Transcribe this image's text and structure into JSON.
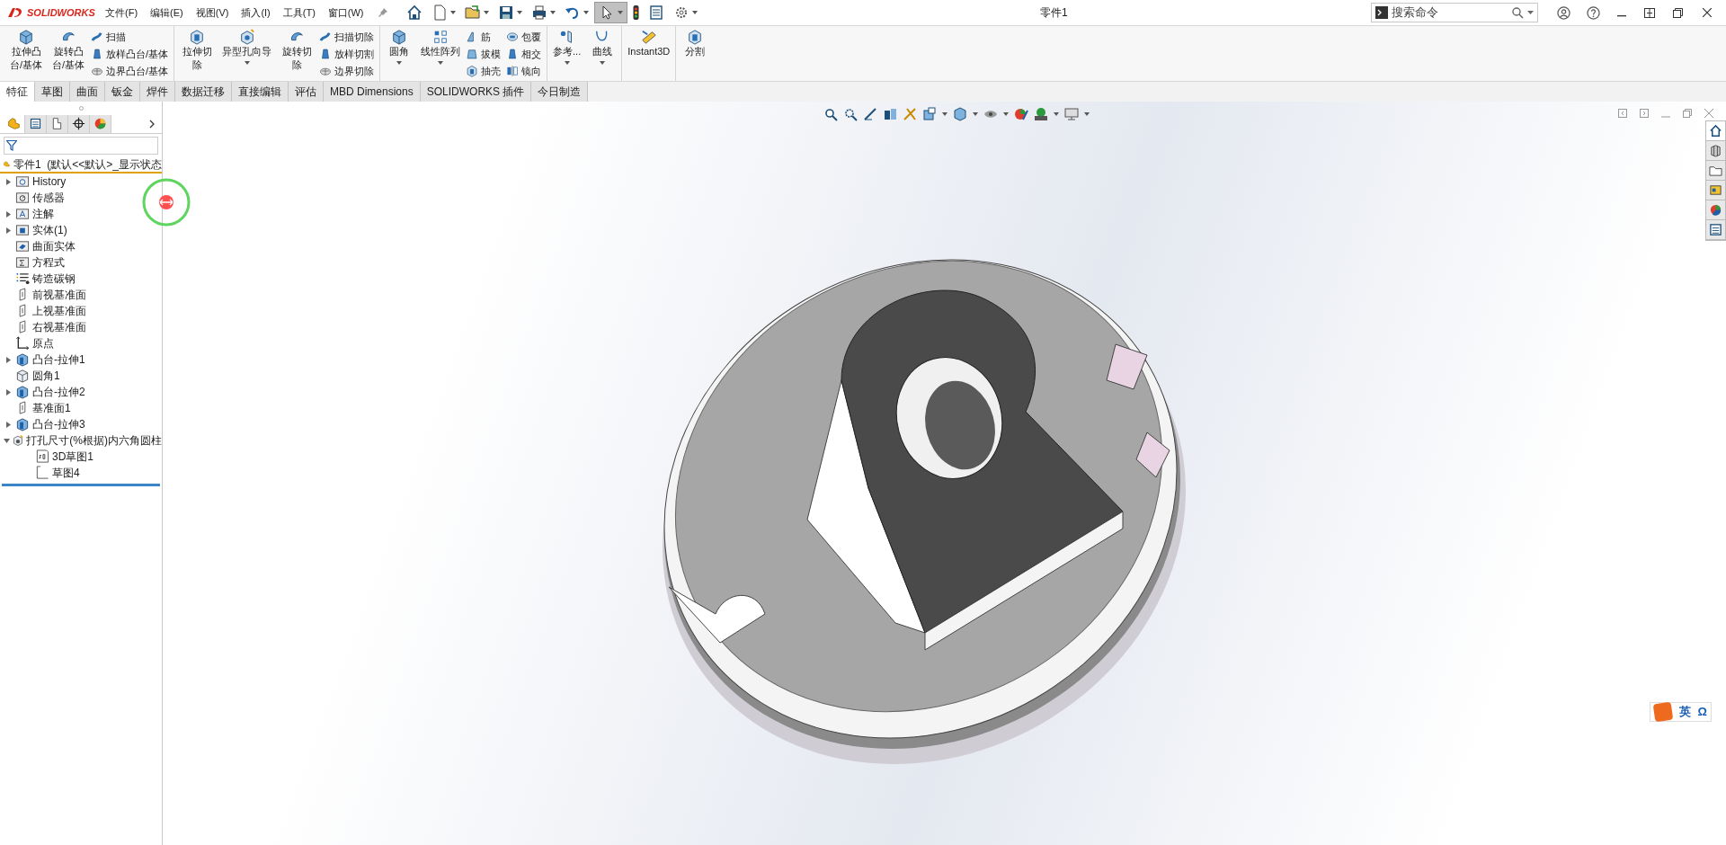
{
  "app": {
    "brand": "SOLIDWORKS",
    "title": "零件1"
  },
  "menu": [
    {
      "label": "文件(F)"
    },
    {
      "label": "编辑(E)"
    },
    {
      "label": "视图(V)"
    },
    {
      "label": "插入(I)"
    },
    {
      "label": "工具(T)"
    },
    {
      "label": "窗口(W)"
    }
  ],
  "quick_toolbar": [
    {
      "kind": "home",
      "caret": false,
      "selected": false
    },
    {
      "kind": "new",
      "caret": true,
      "selected": false
    },
    {
      "kind": "open",
      "caret": true,
      "selected": false
    },
    {
      "kind": "save",
      "caret": true,
      "selected": false
    },
    {
      "kind": "print",
      "caret": true,
      "selected": false
    },
    {
      "kind": "undo",
      "caret": true,
      "selected": false
    },
    {
      "kind": "select",
      "caret": true,
      "selected": true
    },
    {
      "kind": "light",
      "caret": false,
      "selected": false
    },
    {
      "kind": "list",
      "caret": false,
      "selected": false
    },
    {
      "kind": "gear",
      "caret": true,
      "selected": false
    }
  ],
  "search": {
    "placeholder": "搜索命令"
  },
  "ribbon": [
    {
      "columns": [
        {
          "kind": "tall",
          "items": [
            {
              "label": "拉伸凸台/基体",
              "kind": "cube",
              "caret": false
            }
          ]
        },
        {
          "kind": "tall",
          "items": [
            {
              "label": "旋转凸台/基体",
              "kind": "revolve",
              "caret": false
            }
          ]
        },
        {
          "kind": "small",
          "items": [
            {
              "label": "扫描",
              "kind": "sweep"
            },
            {
              "label": "放样凸台/基体",
              "kind": "loft"
            },
            {
              "label": "边界凸台/基体",
              "kind": "boundary"
            }
          ]
        }
      ]
    },
    {
      "columns": [
        {
          "kind": "tall",
          "items": [
            {
              "label": "拉伸切除",
              "kind": "cut",
              "caret": false
            }
          ]
        },
        {
          "kind": "large",
          "items": [
            {
              "label": "异型孔向导",
              "kind": "hole",
              "caret": true
            }
          ]
        },
        {
          "kind": "tall",
          "items": [
            {
              "label": "旋转切除",
              "kind": "revolve",
              "caret": false
            }
          ]
        },
        {
          "kind": "small",
          "items": [
            {
              "label": "扫描切除",
              "kind": "sweep"
            },
            {
              "label": "放样切割",
              "kind": "loft"
            },
            {
              "label": "边界切除",
              "kind": "boundary"
            }
          ]
        }
      ]
    },
    {
      "columns": [
        {
          "kind": "large",
          "items": [
            {
              "label": "圆角",
              "kind": "cube",
              "caret": true
            }
          ]
        },
        {
          "kind": "large",
          "items": [
            {
              "label": "线性阵列",
              "kind": "pattern",
              "caret": true
            }
          ]
        },
        {
          "kind": "small",
          "items": [
            {
              "label": "筋",
              "kind": "rib"
            },
            {
              "label": "拔模",
              "kind": "draft"
            },
            {
              "label": "抽壳",
              "kind": "cut"
            }
          ]
        },
        {
          "kind": "small",
          "items": [
            {
              "label": "包覆",
              "kind": "wrap"
            },
            {
              "label": "相交",
              "kind": "loft"
            },
            {
              "label": "镜向",
              "kind": "mirror"
            }
          ]
        }
      ]
    },
    {
      "columns": [
        {
          "kind": "large",
          "items": [
            {
              "label": "参考...",
              "kind": "reference",
              "caret": true
            }
          ]
        },
        {
          "kind": "large",
          "items": [
            {
              "label": "曲线",
              "kind": "curve",
              "caret": true
            }
          ]
        }
      ]
    },
    {
      "columns": [
        {
          "kind": "large",
          "items": [
            {
              "label": "Instant3D",
              "kind": "ruler",
              "caret": false
            }
          ]
        }
      ]
    },
    {
      "columns": [
        {
          "kind": "large",
          "items": [
            {
              "label": "分割",
              "kind": "cut",
              "caret": false
            }
          ]
        }
      ]
    }
  ],
  "tabs": [
    {
      "label": "特征",
      "selected": true
    },
    {
      "label": "草图",
      "selected": false
    },
    {
      "label": "曲面",
      "selected": false
    },
    {
      "label": "钣金",
      "selected": false
    },
    {
      "label": "焊件",
      "selected": false
    },
    {
      "label": "数据迁移",
      "selected": false
    },
    {
      "label": "直接编辑",
      "selected": false
    },
    {
      "label": "评估",
      "selected": false
    },
    {
      "label": "MBD Dimensions",
      "selected": false
    },
    {
      "label": "SOLIDWORKS 插件",
      "selected": false
    },
    {
      "label": "今日制造",
      "selected": false
    }
  ],
  "panel_tabs": [
    {
      "kind": "feature",
      "selected": true
    },
    {
      "kind": "property",
      "selected": false
    },
    {
      "kind": "config",
      "selected": false
    },
    {
      "kind": "dim",
      "selected": false
    },
    {
      "kind": "display",
      "selected": false
    }
  ],
  "tree": {
    "root": "零件1  (默认<<默认>_显示状态",
    "items": [
      {
        "label": "History",
        "kind": "history",
        "expanded": false
      },
      {
        "label": "传感器",
        "kind": "sensor"
      },
      {
        "label": "注解",
        "kind": "annotation",
        "expanded": false
      },
      {
        "label": "实体(1)",
        "kind": "solid",
        "expanded": false
      },
      {
        "label": "曲面实体",
        "kind": "surface"
      },
      {
        "label": "方程式",
        "kind": "equation"
      },
      {
        "label": "铸造碳钢",
        "kind": "material"
      },
      {
        "label": "前视基准面",
        "kind": "plane"
      },
      {
        "label": "上视基准面",
        "kind": "plane"
      },
      {
        "label": "右视基准面",
        "kind": "plane"
      },
      {
        "label": "原点",
        "kind": "origin"
      },
      {
        "label": "凸台-拉伸1",
        "kind": "extrude",
        "expanded": false
      },
      {
        "label": "圆角1",
        "kind": "fillet"
      },
      {
        "label": "凸台-拉伸2",
        "kind": "extrude",
        "expanded": false
      },
      {
        "label": "基准面1",
        "kind": "plane"
      },
      {
        "label": "凸台-拉伸3",
        "kind": "extrude",
        "expanded": false
      },
      {
        "label": "打孔尺寸(%根据)内六角圆柱",
        "kind": "hole",
        "expanded": true,
        "children": [
          {
            "label": "3D草图1",
            "kind": "sketch3d"
          },
          {
            "label": "草图4",
            "kind": "sketch"
          }
        ]
      }
    ]
  },
  "ime": {
    "mode": "英",
    "symbol": "Ω"
  }
}
